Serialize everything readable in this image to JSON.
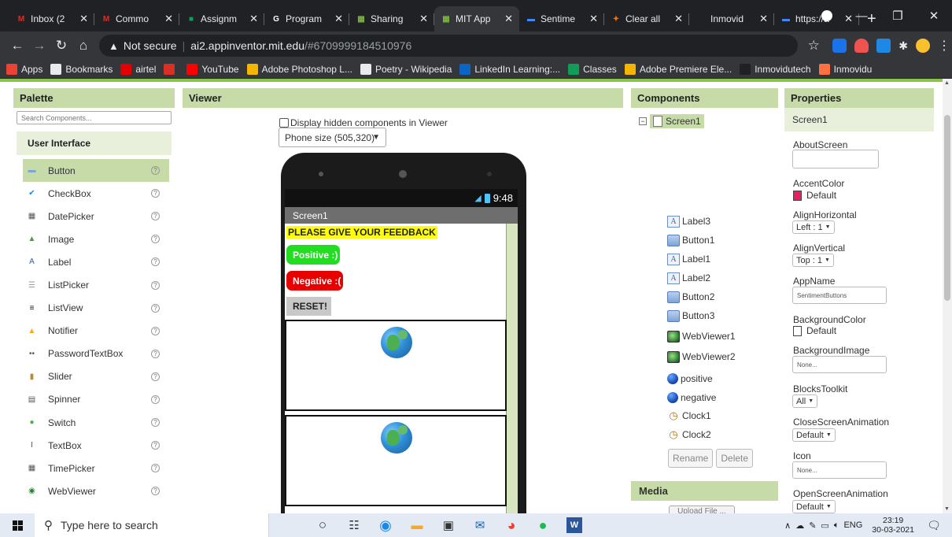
{
  "browser": {
    "tabs": [
      {
        "label": "Inbox (2",
        "icon": "gmail-icon",
        "color": "#d93025",
        "glyph": "M"
      },
      {
        "label": "Commo",
        "icon": "gmail-icon",
        "color": "#d93025",
        "glyph": "M"
      },
      {
        "label": "Assignm",
        "icon": "classroom-icon",
        "color": "#0f9d58",
        "glyph": "■"
      },
      {
        "label": "Program",
        "icon": "google-icon",
        "color": "#fff",
        "glyph": "G"
      },
      {
        "label": "Sharing",
        "icon": "appinventor-icon",
        "color": "#7cb342",
        "glyph": "▦"
      },
      {
        "label": "MIT App",
        "icon": "appinventor-icon",
        "color": "#7cb342",
        "glyph": "▦"
      },
      {
        "label": "Sentime",
        "icon": "screen-icon",
        "color": "#4285f4",
        "glyph": "▬"
      },
      {
        "label": "Clear all",
        "icon": "bolt-icon",
        "color": "#ff6f00",
        "glyph": "✦"
      },
      {
        "label": "Inmovid",
        "icon": "inmovidu-icon",
        "color": "#202124",
        "glyph": "·"
      },
      {
        "label": "https://a",
        "icon": "screen-icon",
        "color": "#4285f4",
        "glyph": "▬"
      }
    ],
    "active_tab": 5,
    "address": {
      "security": "Not secure",
      "host": "ai2.appinventor.mit.edu",
      "path": "/#6709999184510976"
    },
    "bookmarks": [
      {
        "label": "Apps",
        "icon": "apps-grid-icon",
        "color": "#ea4335"
      },
      {
        "label": "Bookmarks",
        "icon": "star-icon",
        "color": "#e8eaed"
      },
      {
        "label": "airtel",
        "icon": "airtel-icon",
        "color": "#e40000"
      },
      {
        "label": "",
        "icon": "gmail-icon",
        "color": "#d93025"
      },
      {
        "label": "YouTube",
        "icon": "youtube-icon",
        "color": "#ff0000"
      },
      {
        "label": "Adobe Photoshop L...",
        "icon": "google-icon",
        "color": "#f4b400"
      },
      {
        "label": "Poetry - Wikipedia",
        "icon": "wikipedia-icon",
        "color": "#e8eaed"
      },
      {
        "label": "LinkedIn Learning:...",
        "icon": "linkedin-icon",
        "color": "#0a66c2"
      },
      {
        "label": "Classes",
        "icon": "classroom-icon",
        "color": "#0f9d58"
      },
      {
        "label": "Adobe Premiere Ele...",
        "icon": "google-icon",
        "color": "#f4b400"
      },
      {
        "label": "Inmovidutech",
        "icon": "inmovidu-icon",
        "color": "#202124"
      },
      {
        "label": "Inmovidu",
        "icon": "inmovidu-icon",
        "color": "#ff7043"
      }
    ]
  },
  "palette": {
    "title": "Palette",
    "search_placeholder": "Search Components...",
    "category": "User Interface",
    "items": [
      {
        "label": "Button",
        "icon": "button-icon",
        "selected": true
      },
      {
        "label": "CheckBox",
        "icon": "checkbox-icon"
      },
      {
        "label": "DatePicker",
        "icon": "calendar-icon"
      },
      {
        "label": "Image",
        "icon": "image-icon"
      },
      {
        "label": "Label",
        "icon": "label-icon"
      },
      {
        "label": "ListPicker",
        "icon": "listpicker-icon"
      },
      {
        "label": "ListView",
        "icon": "listview-icon"
      },
      {
        "label": "Notifier",
        "icon": "warning-icon"
      },
      {
        "label": "PasswordTextBox",
        "icon": "password-icon"
      },
      {
        "label": "Slider",
        "icon": "slider-icon"
      },
      {
        "label": "Spinner",
        "icon": "spinner-icon"
      },
      {
        "label": "Switch",
        "icon": "switch-icon"
      },
      {
        "label": "TextBox",
        "icon": "textbox-icon"
      },
      {
        "label": "TimePicker",
        "icon": "timepicker-icon"
      },
      {
        "label": "WebViewer",
        "icon": "webviewer-icon"
      }
    ],
    "help_glyph": "?"
  },
  "viewer": {
    "title": "Viewer",
    "hidden_toggle": "Display hidden components in Viewer",
    "phone_size": "Phone size (505,320)",
    "status_time": "9:48",
    "screen_title": "Screen1",
    "label_feedback": "PLEASE GIVE YOUR FEEDBACK",
    "button_positive": "Positive :)",
    "button_negative": "Negative :(",
    "button_reset": "RESET!"
  },
  "components": {
    "title": "Components",
    "root": "Screen1",
    "items": [
      {
        "label": "Label3",
        "icon": "label-icon"
      },
      {
        "label": "Button1",
        "icon": "button-icon"
      },
      {
        "label": "Label1",
        "icon": "label-icon"
      },
      {
        "label": "Label2",
        "icon": "label-icon"
      },
      {
        "label": "Button2",
        "icon": "button-icon"
      },
      {
        "label": "Button3",
        "icon": "button-icon"
      },
      {
        "label": "WebViewer1",
        "icon": "webviewer-icon"
      },
      {
        "label": "WebViewer2",
        "icon": "webviewer-icon"
      },
      {
        "label": "positive",
        "icon": "ball-icon"
      },
      {
        "label": "negative",
        "icon": "ball-icon"
      },
      {
        "label": "Clock1",
        "icon": "clock-icon"
      },
      {
        "label": "Clock2",
        "icon": "clock-icon"
      }
    ],
    "rename": "Rename",
    "delete": "Delete",
    "media_title": "Media",
    "upload": "Upload File ..."
  },
  "properties": {
    "title": "Properties",
    "component": "Screen1",
    "about_screen": {
      "label": "AboutScreen",
      "value": ""
    },
    "accent_color": {
      "label": "AccentColor",
      "value": "Default",
      "swatch": "#e91e63"
    },
    "align_horizontal": {
      "label": "AlignHorizontal",
      "value": "Left : 1"
    },
    "align_vertical": {
      "label": "AlignVertical",
      "value": "Top : 1"
    },
    "app_name": {
      "label": "AppName",
      "value": "SentimentButtons"
    },
    "background_color": {
      "label": "BackgroundColor",
      "value": "Default",
      "swatch": "#ffffff"
    },
    "background_image": {
      "label": "BackgroundImage",
      "value": "None..."
    },
    "blocks_toolkit": {
      "label": "BlocksToolkit",
      "value": "All"
    },
    "close_screen_animation": {
      "label": "CloseScreenAnimation",
      "value": "Default"
    },
    "icon": {
      "label": "Icon",
      "value": "None..."
    },
    "open_screen_animation": {
      "label": "OpenScreenAnimation",
      "value": "Default"
    }
  },
  "taskbar": {
    "search_placeholder": "Type here to search",
    "language": "ENG",
    "time": "23:19",
    "date": "30-03-2021"
  },
  "colors": {
    "panel_header": "#c6dba8",
    "accent_green": "#8bc34a",
    "positive_button": "#22dd22",
    "negative_button": "#e80000",
    "feedback_label": "#ffff00"
  }
}
